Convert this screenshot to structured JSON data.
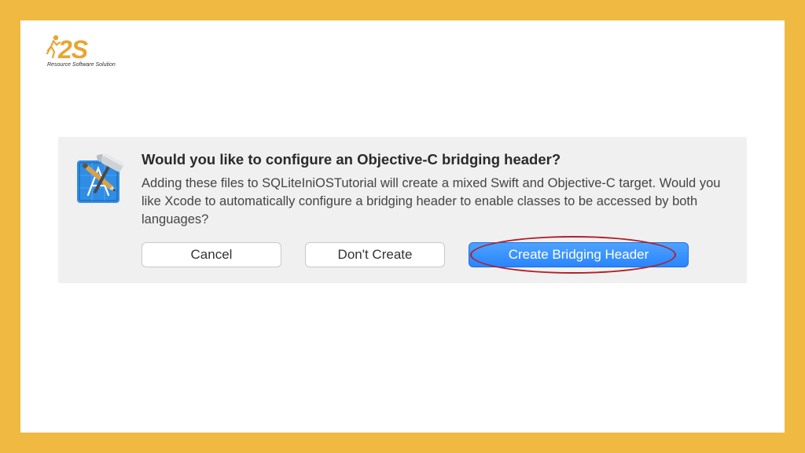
{
  "brand": {
    "logo_char1": "2",
    "logo_char2": "S",
    "tagline": "Resource Software Solution"
  },
  "dialog": {
    "title": "Would you like to configure an Objective-C bridging header?",
    "body": "Adding these files to SQLiteIniOSTutorial will create a mixed Swift and Objective-C target. Would you like Xcode to automatically configure a bridging header to enable classes to be accessed by both languages?",
    "buttons": {
      "cancel": "Cancel",
      "dont_create": "Don't Create",
      "create": "Create Bridging Header"
    }
  },
  "colors": {
    "frame_bg": "#f0b942",
    "dialog_bg": "#f1f0f0",
    "primary_btn": "#2a85ff",
    "highlight": "#b11f2a",
    "logo": "#e8a531"
  }
}
